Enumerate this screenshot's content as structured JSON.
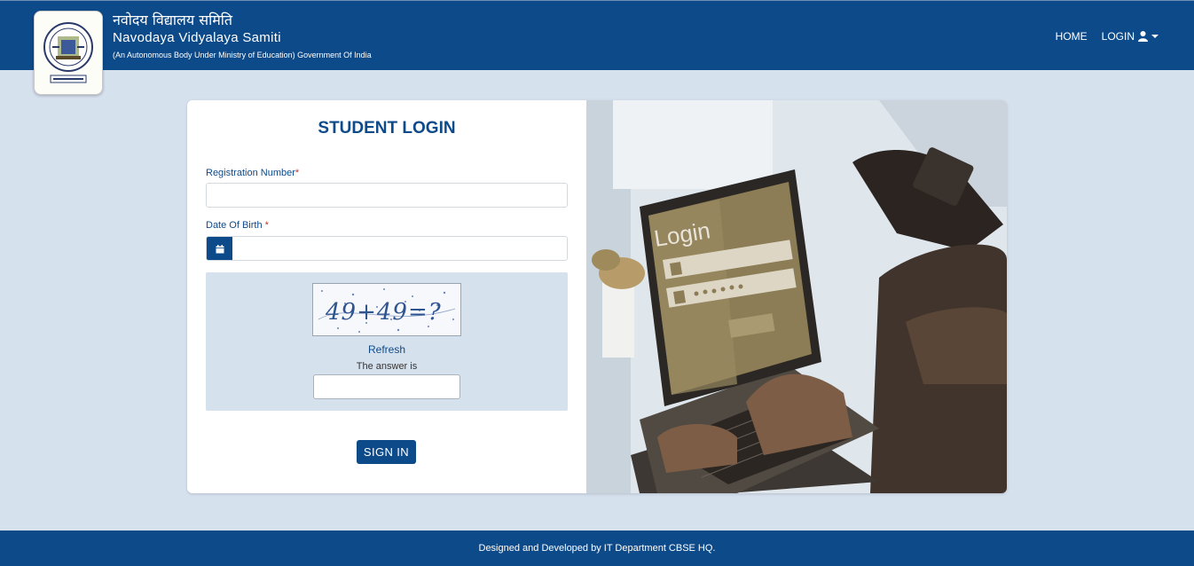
{
  "header": {
    "org_hindi": "नवोदय विद्यालय समिति",
    "org_name": "Navodaya Vidyalaya Samiti",
    "org_subtitle": "(An Autonomous Body Under Ministry of Education) Government Of India",
    "logo_icon": "nvs-emblem-icon",
    "nav": {
      "home": "HOME",
      "login": "LOGIN",
      "login_icon": "user-icon",
      "dropdown_icon": "caret-down-icon"
    }
  },
  "login_form": {
    "title": "STUDENT LOGIN",
    "registration": {
      "label": "Registration Number",
      "required_mark": "*",
      "value": "",
      "placeholder": ""
    },
    "dob": {
      "label": "Date Of Birth ",
      "required_mark": "*",
      "value": "",
      "placeholder": "",
      "icon": "calendar-icon"
    },
    "captcha": {
      "image_text": "49+49=?",
      "refresh_label": "Refresh",
      "answer_label": "The answer is",
      "answer_value": ""
    },
    "submit_label": "SIGN IN"
  },
  "side_image": {
    "screen_title": "Login"
  },
  "footer": {
    "text": "Designed and Developed by IT Department CBSE HQ."
  },
  "colors": {
    "primary": "#0d4a8a",
    "background": "#d6e1ee",
    "required": "#c0392b"
  }
}
